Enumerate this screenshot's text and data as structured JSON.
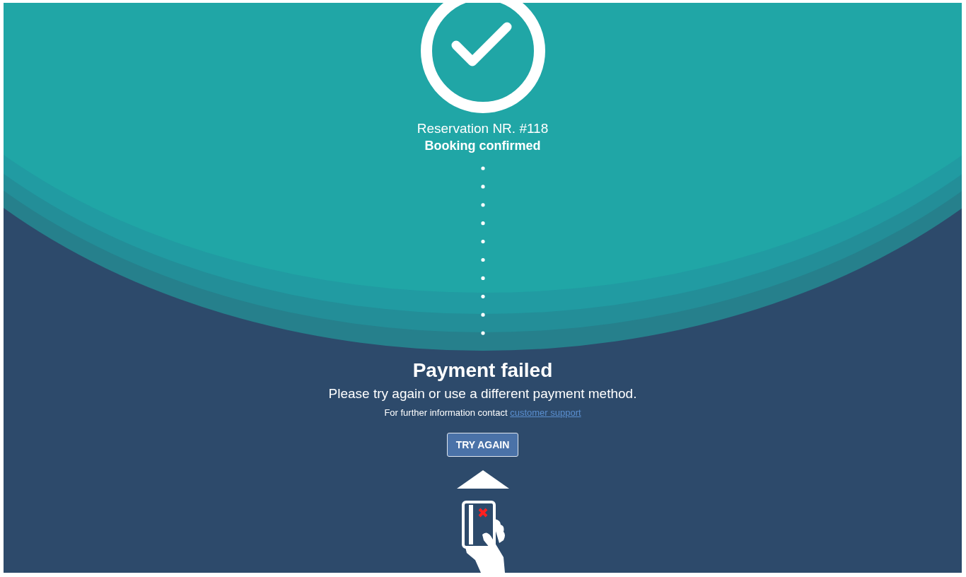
{
  "reservation": {
    "number": "Reservation NR. #118",
    "status": "Booking confirmed"
  },
  "payment": {
    "title": "Payment failed",
    "message": "Please try again or use a different payment method.",
    "contact_text": "For further information contact",
    "contact_link": "customer support",
    "button": "TRY AGAIN"
  }
}
